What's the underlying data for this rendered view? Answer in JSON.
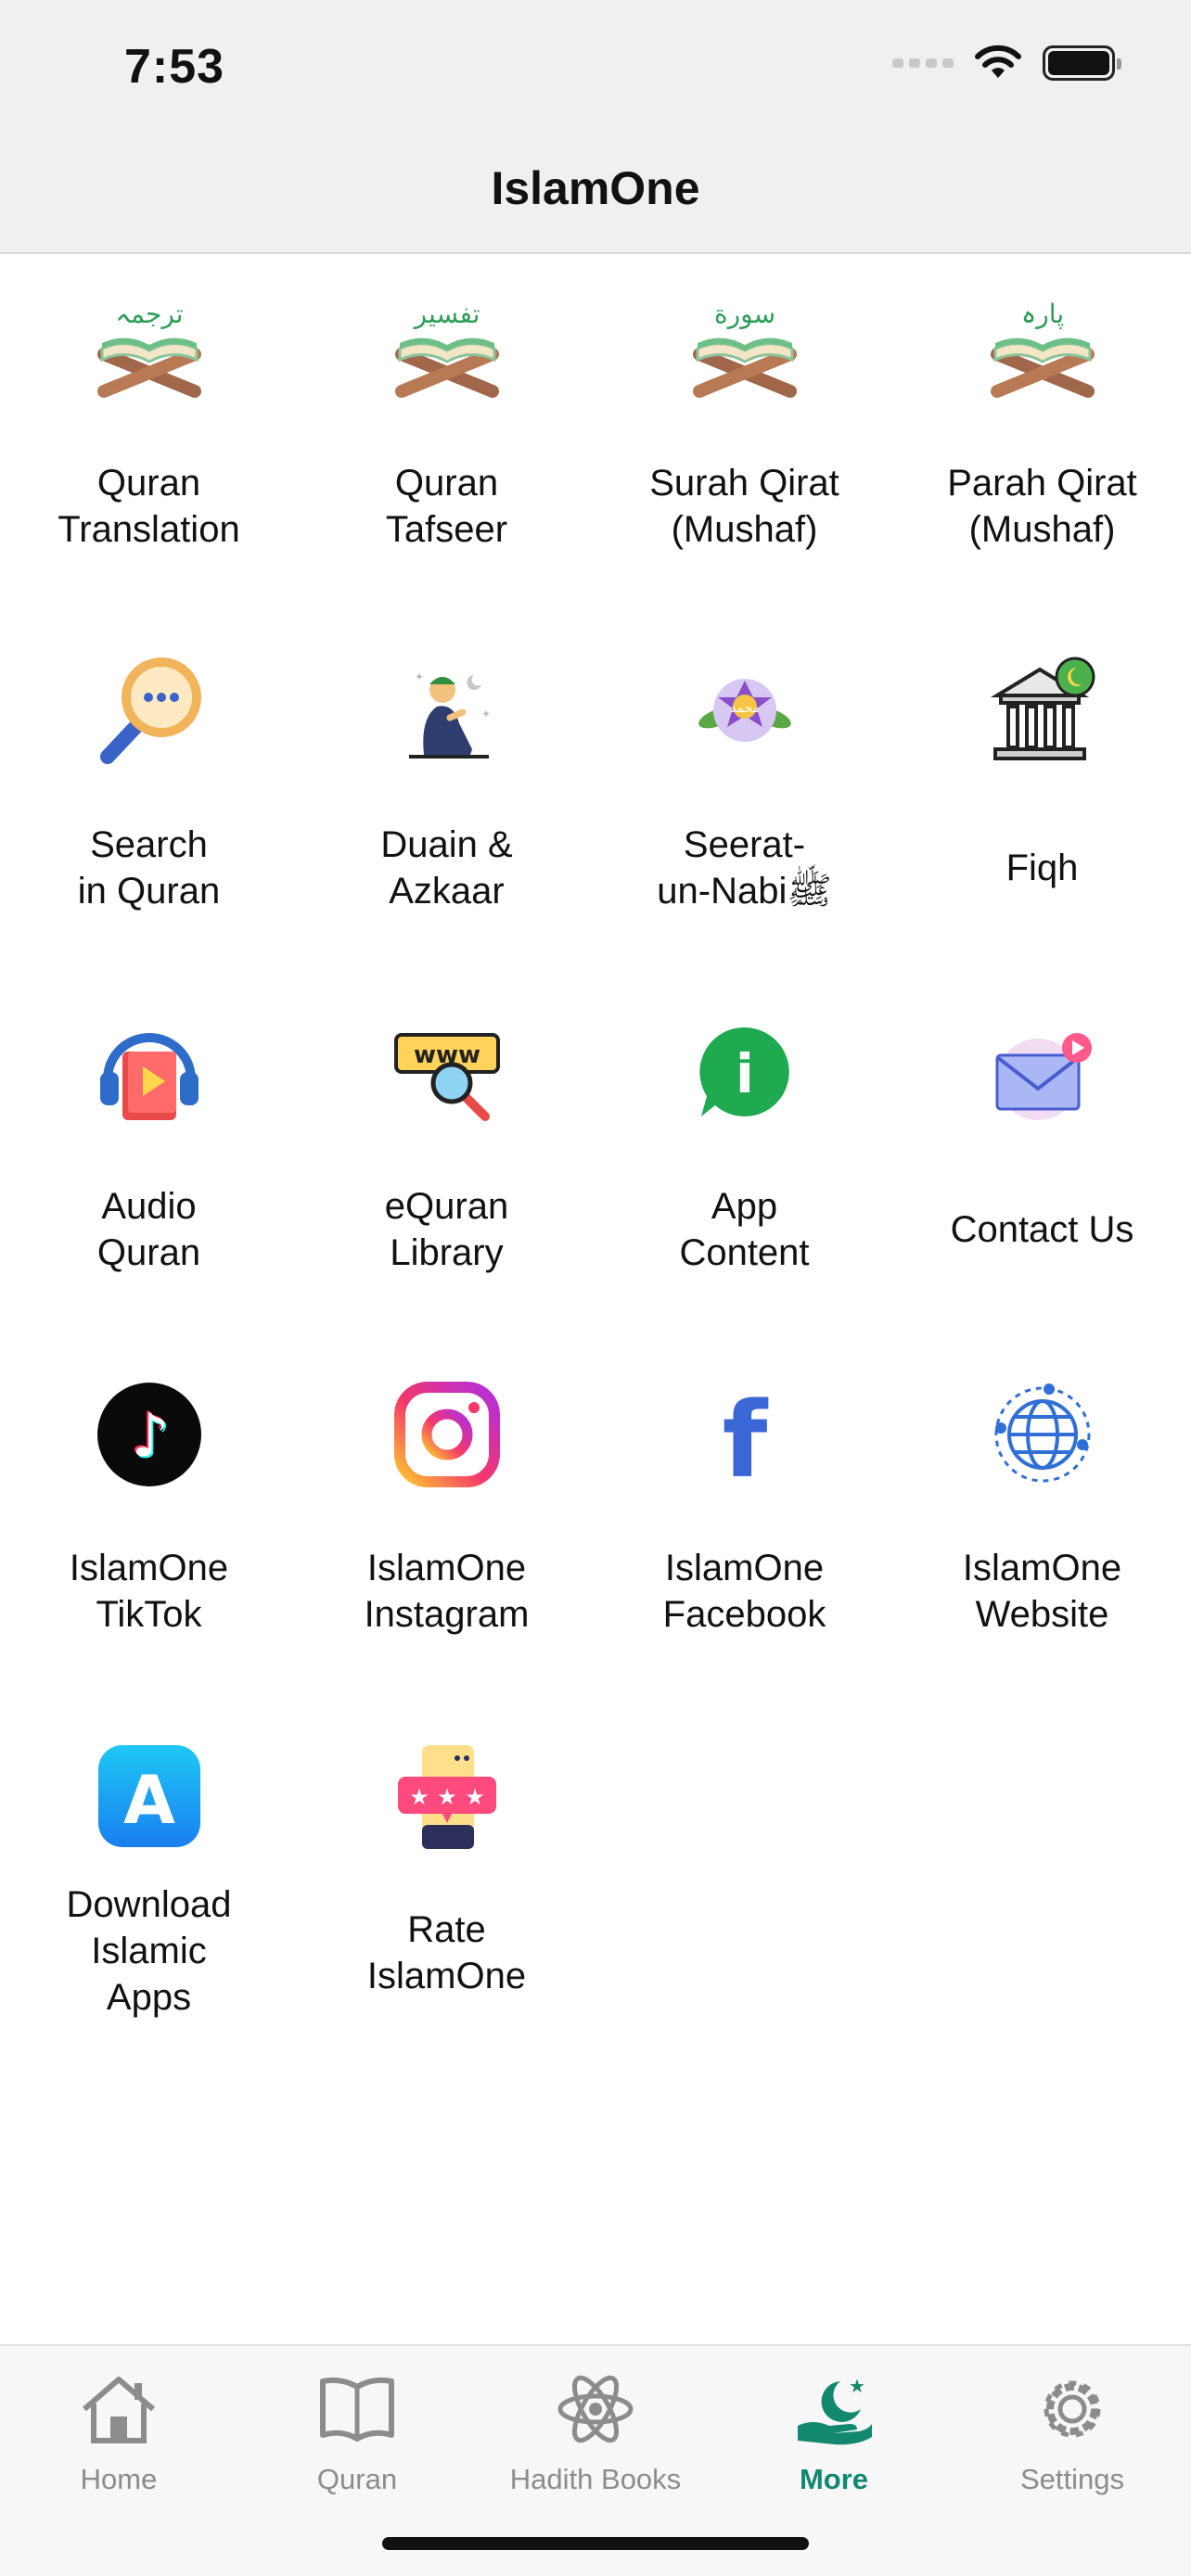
{
  "status_bar": {
    "time": "7:53"
  },
  "header": {
    "title": "IslamOne"
  },
  "tiles": [
    {
      "label": "Quran\nTranslation",
      "icon": "quran-stand-translation-icon",
      "arabic": "ترجمہ"
    },
    {
      "label": "Quran\nTafseer",
      "icon": "quran-stand-tafseer-icon",
      "arabic": "تفسیر"
    },
    {
      "label": "Surah Qirat\n(Mushaf)",
      "icon": "quran-stand-surah-icon",
      "arabic": "سورة"
    },
    {
      "label": "Parah Qirat\n(Mushaf)",
      "icon": "quran-stand-parah-icon",
      "arabic": "پارہ"
    },
    {
      "label": "Search\nin Quran",
      "icon": "search-icon"
    },
    {
      "label": "Duain &\nAzkaar",
      "icon": "praying-man-icon"
    },
    {
      "label": "Seerat-\nun-Nabiﷺ",
      "icon": "seerat-icon",
      "arabic": "محمد"
    },
    {
      "label": "Fiqh",
      "icon": "fiqh-building-icon"
    },
    {
      "label": "Audio\nQuran",
      "icon": "audio-headphones-icon"
    },
    {
      "label": "eQuran\nLibrary",
      "icon": "www-search-icon",
      "www": "www"
    },
    {
      "label": "App\nContent",
      "icon": "info-bubble-icon",
      "info": "i"
    },
    {
      "label": "Contact Us",
      "icon": "envelope-icon"
    },
    {
      "label": "IslamOne\nTikTok",
      "icon": "tiktok-icon",
      "glyph": "♪"
    },
    {
      "label": "IslamOne\nInstagram",
      "icon": "instagram-icon"
    },
    {
      "label": "IslamOne\nFacebook",
      "icon": "facebook-icon",
      "glyph": "f"
    },
    {
      "label": "IslamOne\nWebsite",
      "icon": "globe-icon"
    },
    {
      "label": "Download\nIslamic\nApps",
      "icon": "app-store-icon",
      "glyph": "A"
    },
    {
      "label": "Rate\nIslamOne",
      "icon": "rate-stars-icon"
    }
  ],
  "tabs": [
    {
      "label": "Home",
      "icon": "home-icon",
      "active": false
    },
    {
      "label": "Quran",
      "icon": "book-icon",
      "active": false
    },
    {
      "label": "Hadith Books",
      "icon": "atom-icon",
      "active": false
    },
    {
      "label": "More",
      "icon": "crescent-hand-icon",
      "active": true
    },
    {
      "label": "Settings",
      "icon": "gear-icon",
      "active": false
    }
  ],
  "colors": {
    "accent": "#12886f",
    "inactive": "#8c8c8c",
    "header_bg": "#f0f0f0"
  }
}
